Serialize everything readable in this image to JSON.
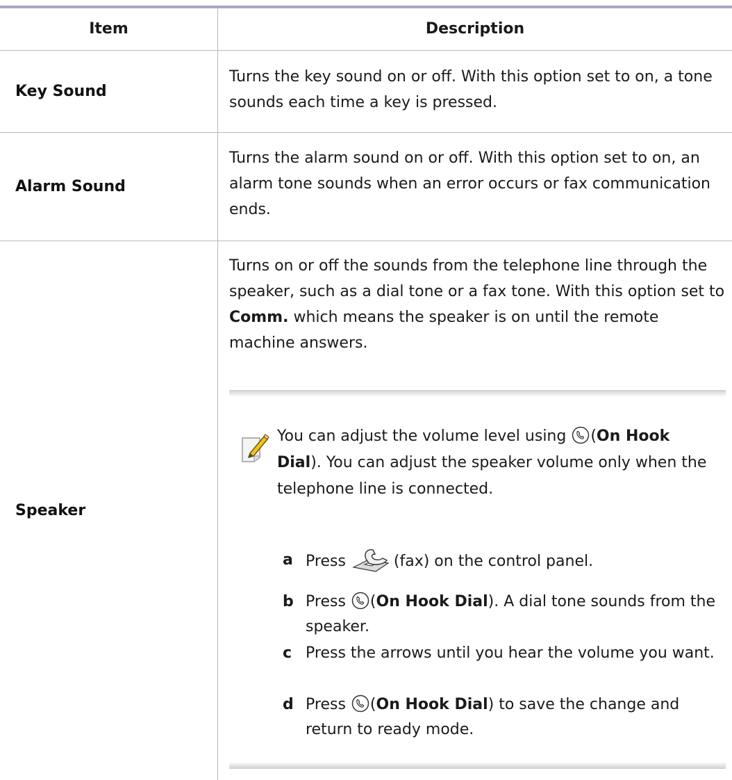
{
  "table": {
    "headers": {
      "item": "Item",
      "description": "Description"
    },
    "rows": [
      {
        "item": "Key Sound",
        "description": "Turns the key sound on or off. With this option set to on, a tone sounds each time a key is pressed."
      },
      {
        "item": "Alarm Sound",
        "description": "Turns the alarm sound on or off. With this option set to on, an alarm tone sounds when an error occurs or fax communication ends."
      },
      {
        "item": "Speaker",
        "description_prefix": "Turns on or off the sounds from the telephone line through the speaker, such as a dial tone or a fax tone. With this option set to ",
        "description_bold": "Comm.",
        "description_suffix": " which means the speaker is on until the remote machine answers."
      }
    ]
  },
  "note": {
    "icon": "note-pencil-icon",
    "text_prefix": "You can adjust the volume level using ",
    "on_hook_label": "On Hook Dial",
    "text_suffix": "). You can adjust the speaker volume only when the telephone line is connected.",
    "steps": [
      {
        "letter": "a",
        "pre": "Press ",
        "post": "(fax) on the control panel."
      },
      {
        "letter": "b",
        "pre": "Press ",
        "bold": "On Hook Dial",
        "post": "). A dial tone sounds from the speaker."
      },
      {
        "letter": "c",
        "text": "Press the arrows until you hear the volume you want."
      },
      {
        "letter": "d",
        "pre": "Press ",
        "bold": "On Hook Dial",
        "post": ") to save the change and return to ready mode."
      }
    ]
  },
  "colors": {
    "top_rule": "#a8a6c8",
    "grid": "#b9b9b9",
    "note_shade": "#cfcfcf",
    "icon_yellow": "#f2c21b"
  }
}
